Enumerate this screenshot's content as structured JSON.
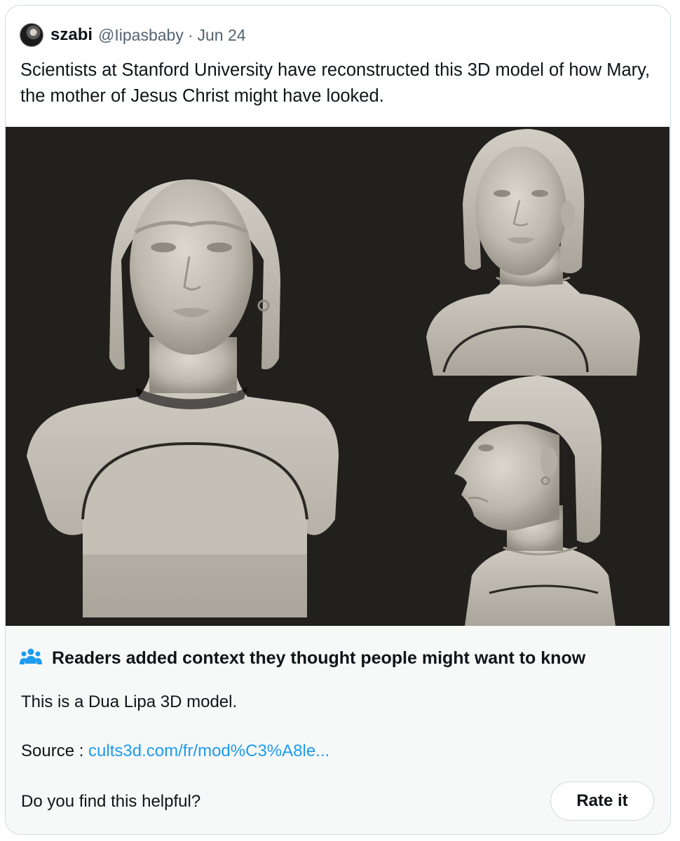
{
  "tweet": {
    "display_name": "szabi",
    "handle": "@Iipasbaby",
    "separator": "·",
    "date": "Jun 24",
    "text": "Scientists at Stanford University have reconstructed this 3D model of how Mary, the mother of Jesus Christ might have looked.",
    "media": {
      "description_icon": "image-bust-renders",
      "background_color": "#22201d",
      "sculpt_color": "#c9c5bc"
    }
  },
  "community_note": {
    "icon": "people-icon",
    "title": "Readers added context they thought people might want to know",
    "body": "This is a Dua Lipa 3D model.",
    "source_label": "Source : ",
    "source_link": "cults3d.com/fr/mod%C3%A8le...",
    "helpful_question": "Do you find this helpful?",
    "rate_button": "Rate it",
    "link_color": "#1d9bf0",
    "icon_color": "#1d9bf0"
  }
}
